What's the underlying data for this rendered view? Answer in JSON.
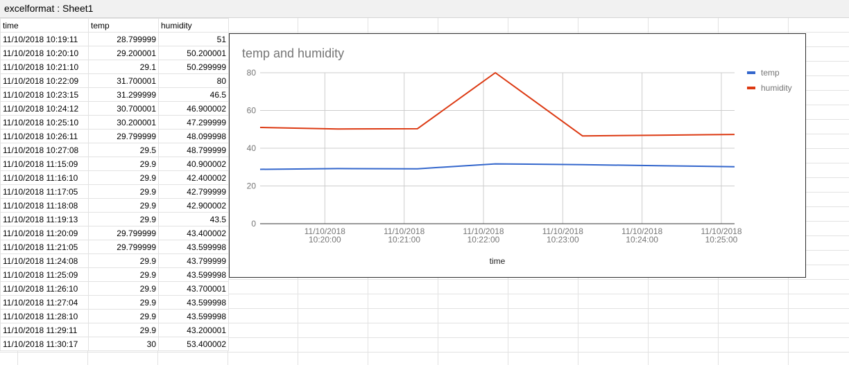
{
  "window": {
    "title": "excelformat : Sheet1"
  },
  "sheet": {
    "headers": [
      "time",
      "temp",
      "humidity"
    ],
    "rows": [
      [
        "11/10/2018 10:19:11",
        "28.799999",
        "51"
      ],
      [
        "11/10/2018 10:20:10",
        "29.200001",
        "50.200001"
      ],
      [
        "11/10/2018 10:21:10",
        "29.1",
        "50.299999"
      ],
      [
        "11/10/2018 10:22:09",
        "31.700001",
        "80"
      ],
      [
        "11/10/2018 10:23:15",
        "31.299999",
        "46.5"
      ],
      [
        "11/10/2018 10:24:12",
        "30.700001",
        "46.900002"
      ],
      [
        "11/10/2018 10:25:10",
        "30.200001",
        "47.299999"
      ],
      [
        "11/10/2018 10:26:11",
        "29.799999",
        "48.099998"
      ],
      [
        "11/10/2018 10:27:08",
        "29.5",
        "48.799999"
      ],
      [
        "11/10/2018 11:15:09",
        "29.9",
        "40.900002"
      ],
      [
        "11/10/2018 11:16:10",
        "29.9",
        "42.400002"
      ],
      [
        "11/10/2018 11:17:05",
        "29.9",
        "42.799999"
      ],
      [
        "11/10/2018 11:18:08",
        "29.9",
        "42.900002"
      ],
      [
        "11/10/2018 11:19:13",
        "29.9",
        "43.5"
      ],
      [
        "11/10/2018 11:20:09",
        "29.799999",
        "43.400002"
      ],
      [
        "11/10/2018 11:21:05",
        "29.799999",
        "43.599998"
      ],
      [
        "11/10/2018 11:24:08",
        "29.9",
        "43.799999"
      ],
      [
        "11/10/2018 11:25:09",
        "29.9",
        "43.599998"
      ],
      [
        "11/10/2018 11:26:10",
        "29.9",
        "43.700001"
      ],
      [
        "11/10/2018 11:27:04",
        "29.9",
        "43.599998"
      ],
      [
        "11/10/2018 11:28:10",
        "29.9",
        "43.599998"
      ],
      [
        "11/10/2018 11:29:11",
        "29.9",
        "43.200001"
      ],
      [
        "11/10/2018 11:30:17",
        "30",
        "53.400002"
      ]
    ]
  },
  "chart_data": {
    "type": "line",
    "title": "temp and humidity",
    "xlabel": "time",
    "ylabel": "",
    "ylim": [
      0,
      80
    ],
    "yticks": [
      0,
      20,
      40,
      60,
      80
    ],
    "xlim": [
      "11/10/2018 10:19:11",
      "11/10/2018 10:25:10"
    ],
    "xticks": [
      {
        "time": "11/10/2018 10:20:00",
        "date_label": "11/10/2018",
        "time_label": "10:20:00"
      },
      {
        "time": "11/10/2018 10:21:00",
        "date_label": "11/10/2018",
        "time_label": "10:21:00"
      },
      {
        "time": "11/10/2018 10:22:00",
        "date_label": "11/10/2018",
        "time_label": "10:22:00"
      },
      {
        "time": "11/10/2018 10:23:00",
        "date_label": "11/10/2018",
        "time_label": "10:23:00"
      },
      {
        "time": "11/10/2018 10:24:00",
        "date_label": "11/10/2018",
        "time_label": "10:24:00"
      },
      {
        "time": "11/10/2018 10:25:00",
        "date_label": "11/10/2018",
        "time_label": "10:25:00"
      }
    ],
    "x": [
      "11/10/2018 10:19:11",
      "11/10/2018 10:20:10",
      "11/10/2018 10:21:10",
      "11/10/2018 10:22:09",
      "11/10/2018 10:23:15",
      "11/10/2018 10:24:12",
      "11/10/2018 10:25:10"
    ],
    "series": [
      {
        "name": "temp",
        "color": "#3366cc",
        "values": [
          28.8,
          29.2,
          29.1,
          31.7,
          31.3,
          30.7,
          30.2
        ]
      },
      {
        "name": "humidity",
        "color": "#dc3912",
        "values": [
          51,
          50.2,
          50.3,
          80,
          46.5,
          46.9,
          47.3
        ]
      }
    ],
    "grid": true,
    "legend": "right",
    "colors": {
      "gridline": "#cccccc",
      "baseline": "#333333",
      "text": "#757575"
    }
  }
}
